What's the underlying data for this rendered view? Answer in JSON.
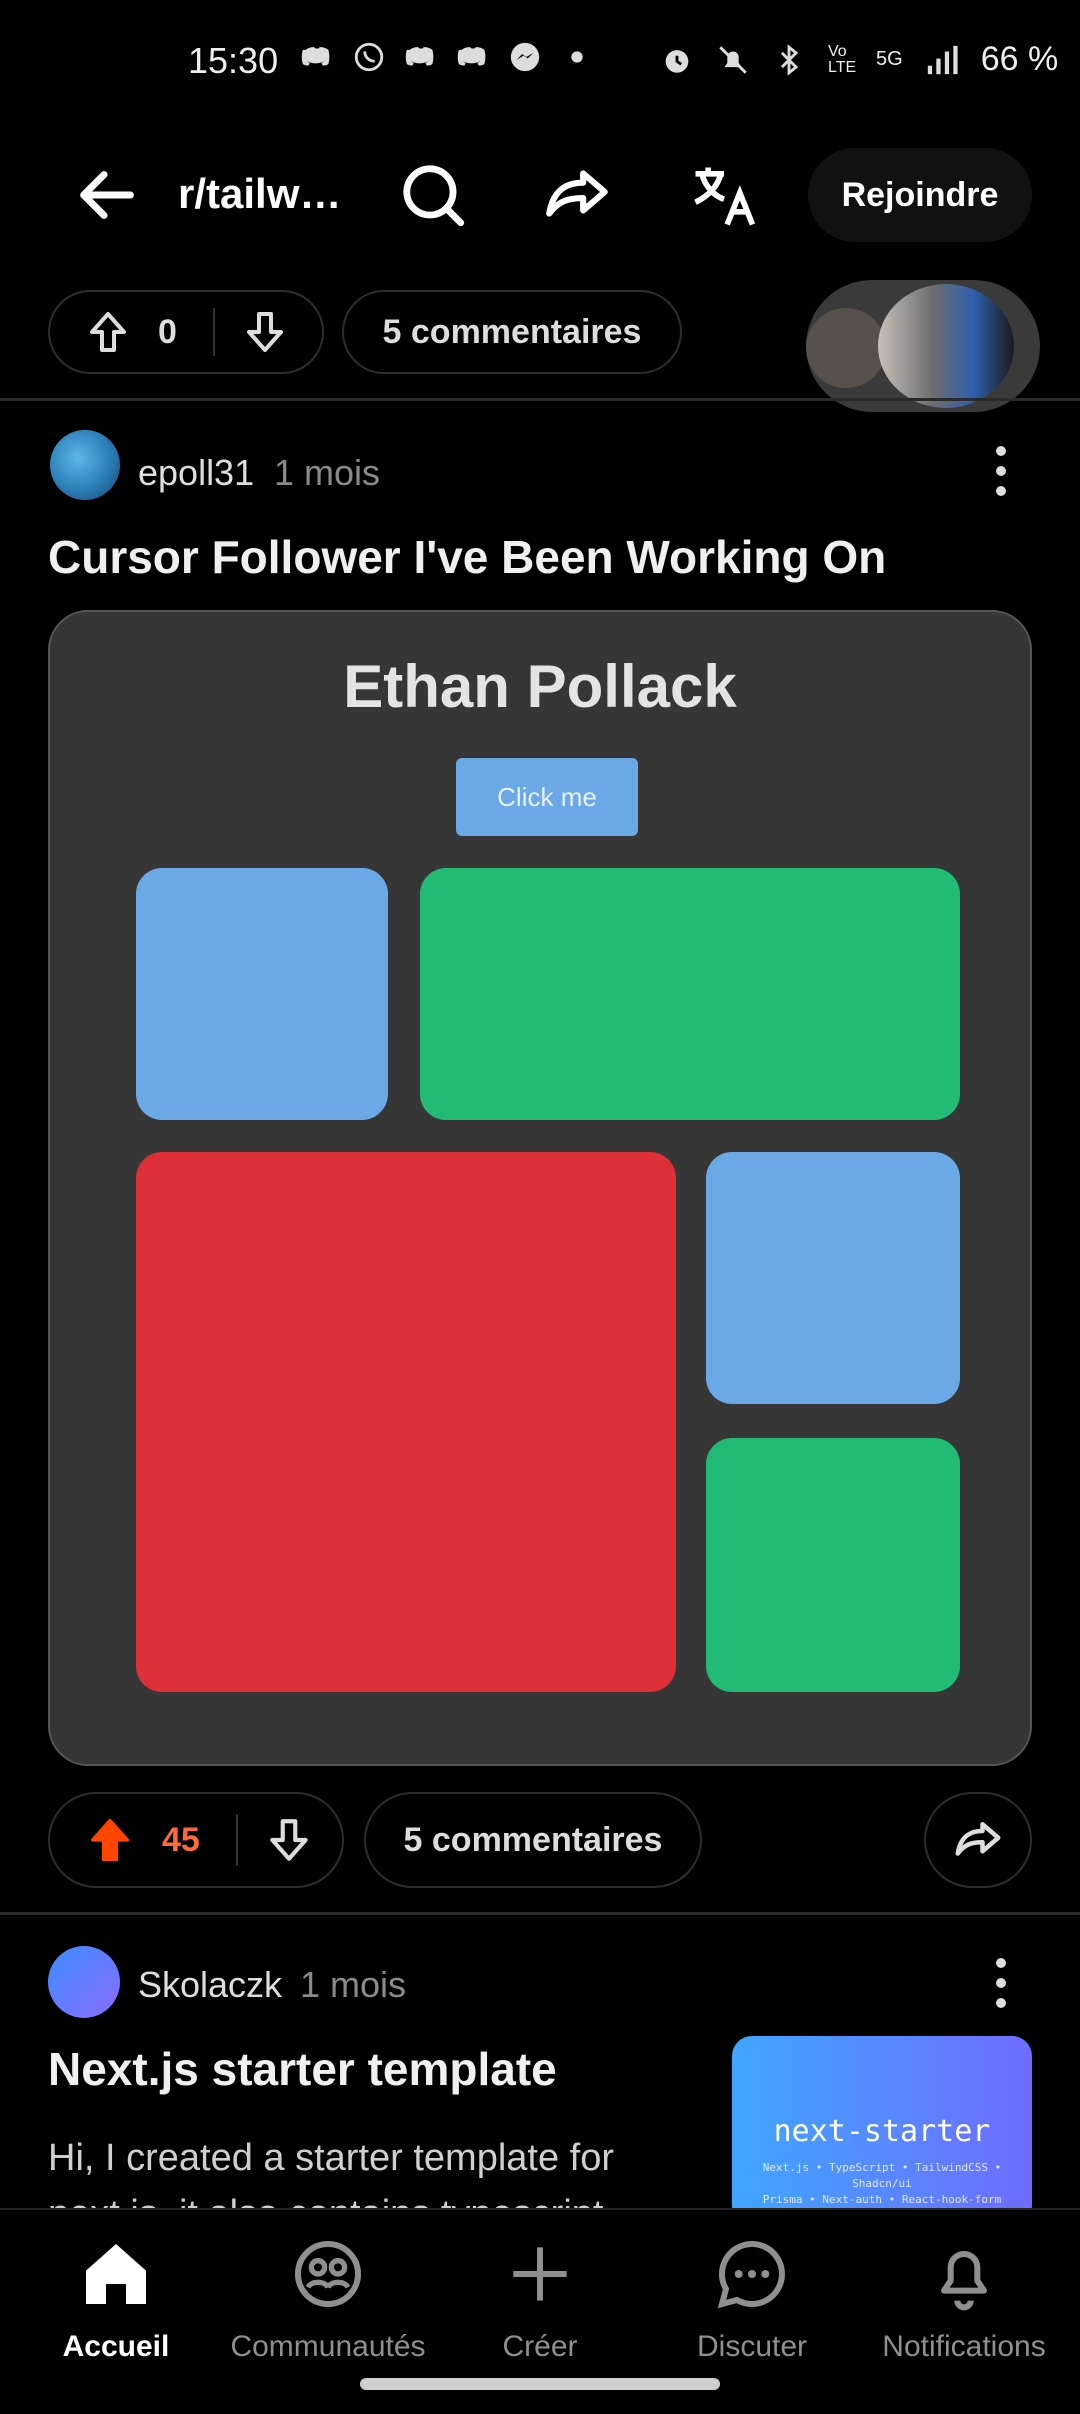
{
  "status_bar": {
    "time": "15:30",
    "battery": "66 %",
    "network": "5G",
    "volte": "Vo LTE"
  },
  "header": {
    "title": "r/tailw…",
    "join_label": "Rejoindre"
  },
  "previous_post": {
    "score": "0",
    "comments_label": "5 commentaires"
  },
  "post": {
    "username": "epoll31",
    "age": "1 mois",
    "title": "Cursor Follower I've Been Working On",
    "media": {
      "heading": "Ethan Pollack",
      "button_label": "Click me",
      "colors": {
        "blue": "#6aa8e6",
        "green": "#22bb76",
        "red": "#dd3038",
        "panel": "#363636"
      }
    },
    "score": "45",
    "comments_label": "5 commentaires",
    "upvoted": true,
    "upvote_color": "#ff4500"
  },
  "next_post": {
    "username": "Skolaczk",
    "age": "1 mois",
    "title": "Next.js starter template",
    "excerpt_line1": "Hi, I created a starter template for",
    "excerpt_line2": "next.js, it also contains typescript,",
    "thumbnail": {
      "title": "next-starter",
      "subtitle_line1": "Next.js • TypeScript • TailwindCSS • Shadcn/ui",
      "subtitle_line2": "Prisma • Next-auth • React-hook-form"
    }
  },
  "bottom_nav": {
    "items": [
      {
        "label": "Accueil",
        "icon": "home-icon",
        "active": true
      },
      {
        "label": "Communautés",
        "icon": "communities-icon",
        "active": false
      },
      {
        "label": "Créer",
        "icon": "plus-icon",
        "active": false
      },
      {
        "label": "Discuter",
        "icon": "chat-icon",
        "active": false
      },
      {
        "label": "Notifications",
        "icon": "bell-icon",
        "active": false
      }
    ]
  }
}
